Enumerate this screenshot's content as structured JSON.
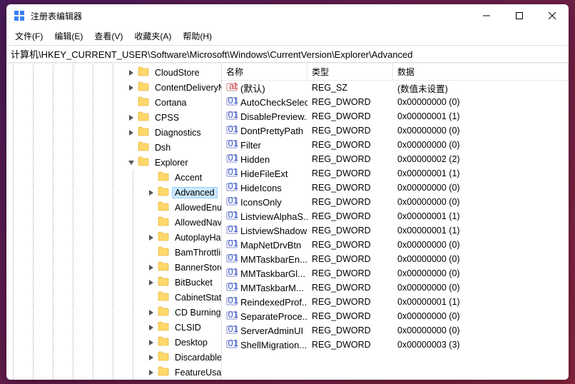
{
  "window": {
    "title": "注册表编辑器"
  },
  "menu": {
    "file": "文件(F)",
    "edit": "编辑(E)",
    "view": "查看(V)",
    "favorites": "收藏夹(A)",
    "help": "帮助(H)"
  },
  "address": "计算机\\HKEY_CURRENT_USER\\Software\\Microsoft\\Windows\\CurrentVersion\\Explorer\\Advanced",
  "tree": [
    {
      "depth": 7,
      "twisty": ">",
      "label": "CloudStore"
    },
    {
      "depth": 7,
      "twisty": ">",
      "label": "ContentDeliveryM"
    },
    {
      "depth": 7,
      "twisty": "",
      "label": "Cortana"
    },
    {
      "depth": 7,
      "twisty": ">",
      "label": "CPSS"
    },
    {
      "depth": 7,
      "twisty": ">",
      "label": "Diagnostics"
    },
    {
      "depth": 7,
      "twisty": "",
      "label": "Dsh"
    },
    {
      "depth": 7,
      "twisty": "v",
      "label": "Explorer"
    },
    {
      "depth": 8,
      "twisty": "",
      "label": "Accent"
    },
    {
      "depth": 8,
      "twisty": ">",
      "label": "Advanced",
      "selected": true
    },
    {
      "depth": 8,
      "twisty": "",
      "label": "AllowedEnume"
    },
    {
      "depth": 8,
      "twisty": "",
      "label": "AllowedNaviga"
    },
    {
      "depth": 8,
      "twisty": ">",
      "label": "AutoplayHand"
    },
    {
      "depth": 8,
      "twisty": "",
      "label": "BamThrottling"
    },
    {
      "depth": 8,
      "twisty": ">",
      "label": "BannerStore"
    },
    {
      "depth": 8,
      "twisty": ">",
      "label": "BitBucket"
    },
    {
      "depth": 8,
      "twisty": "",
      "label": "CabinetState"
    },
    {
      "depth": 8,
      "twisty": ">",
      "label": "CD Burning"
    },
    {
      "depth": 8,
      "twisty": ">",
      "label": "CLSID"
    },
    {
      "depth": 8,
      "twisty": ">",
      "label": "Desktop"
    },
    {
      "depth": 8,
      "twisty": ">",
      "label": "Discardable"
    },
    {
      "depth": 8,
      "twisty": ">",
      "label": "FeatureUsage"
    }
  ],
  "columns": {
    "name": "名称",
    "type": "类型",
    "data": "数据"
  },
  "values": [
    {
      "icon": "sz",
      "name": "(默认)",
      "type": "REG_SZ",
      "data": "(数值未设置)"
    },
    {
      "icon": "dw",
      "name": "AutoCheckSelect",
      "type": "REG_DWORD",
      "data": "0x00000000 (0)"
    },
    {
      "icon": "dw",
      "name": "DisablePreview...",
      "type": "REG_DWORD",
      "data": "0x00000001 (1)"
    },
    {
      "icon": "dw",
      "name": "DontPrettyPath",
      "type": "REG_DWORD",
      "data": "0x00000000 (0)"
    },
    {
      "icon": "dw",
      "name": "Filter",
      "type": "REG_DWORD",
      "data": "0x00000000 (0)"
    },
    {
      "icon": "dw",
      "name": "Hidden",
      "type": "REG_DWORD",
      "data": "0x00000002 (2)"
    },
    {
      "icon": "dw",
      "name": "HideFileExt",
      "type": "REG_DWORD",
      "data": "0x00000001 (1)"
    },
    {
      "icon": "dw",
      "name": "HideIcons",
      "type": "REG_DWORD",
      "data": "0x00000000 (0)"
    },
    {
      "icon": "dw",
      "name": "IconsOnly",
      "type": "REG_DWORD",
      "data": "0x00000000 (0)"
    },
    {
      "icon": "dw",
      "name": "ListviewAlphaS...",
      "type": "REG_DWORD",
      "data": "0x00000001 (1)"
    },
    {
      "icon": "dw",
      "name": "ListviewShadow",
      "type": "REG_DWORD",
      "data": "0x00000001 (1)"
    },
    {
      "icon": "dw",
      "name": "MapNetDrvBtn",
      "type": "REG_DWORD",
      "data": "0x00000000 (0)"
    },
    {
      "icon": "dw",
      "name": "MMTaskbarEn...",
      "type": "REG_DWORD",
      "data": "0x00000000 (0)"
    },
    {
      "icon": "dw",
      "name": "MMTaskbarGl...",
      "type": "REG_DWORD",
      "data": "0x00000000 (0)"
    },
    {
      "icon": "dw",
      "name": "MMTaskbarM...",
      "type": "REG_DWORD",
      "data": "0x00000000 (0)"
    },
    {
      "icon": "dw",
      "name": "ReindexedProf...",
      "type": "REG_DWORD",
      "data": "0x00000001 (1)"
    },
    {
      "icon": "dw",
      "name": "SeparateProce...",
      "type": "REG_DWORD",
      "data": "0x00000000 (0)"
    },
    {
      "icon": "dw",
      "name": "ServerAdminUI",
      "type": "REG_DWORD",
      "data": "0x00000000 (0)"
    },
    {
      "icon": "dw",
      "name": "ShellMigration...",
      "type": "REG_DWORD",
      "data": "0x00000003 (3)"
    }
  ]
}
